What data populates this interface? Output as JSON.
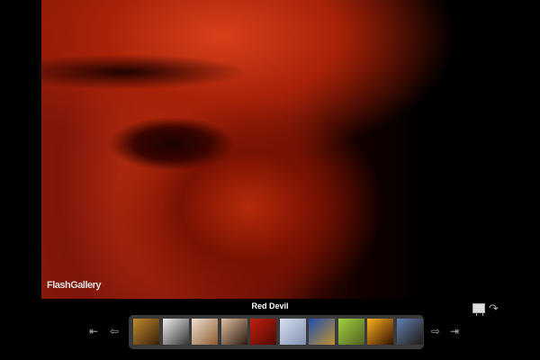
{
  "photo": {
    "title": "Red Devil"
  },
  "logo": {
    "text": "FlashGallery"
  },
  "thumbnails": [
    {
      "colors": [
        "#c08a30",
        "#3a2008"
      ]
    },
    {
      "colors": [
        "#eeeeee",
        "#333333"
      ]
    },
    {
      "colors": [
        "#f0e0d0",
        "#8a5a30"
      ]
    },
    {
      "colors": [
        "#e0c0a0",
        "#2a1a10"
      ]
    },
    {
      "colors": [
        "#c02010",
        "#500800"
      ]
    },
    {
      "colors": [
        "#d8e0f0",
        "#8090b0"
      ]
    },
    {
      "colors": [
        "#2050b0",
        "#c09030"
      ]
    },
    {
      "colors": [
        "#a0d040",
        "#506020"
      ]
    },
    {
      "colors": [
        "#ffb020",
        "#301000"
      ]
    },
    {
      "colors": [
        "#6080b0",
        "#201810"
      ]
    }
  ],
  "controls": {
    "first": "⇤",
    "prev": "⇦",
    "next": "⇨",
    "last": "⇥",
    "rotate": "↷"
  }
}
